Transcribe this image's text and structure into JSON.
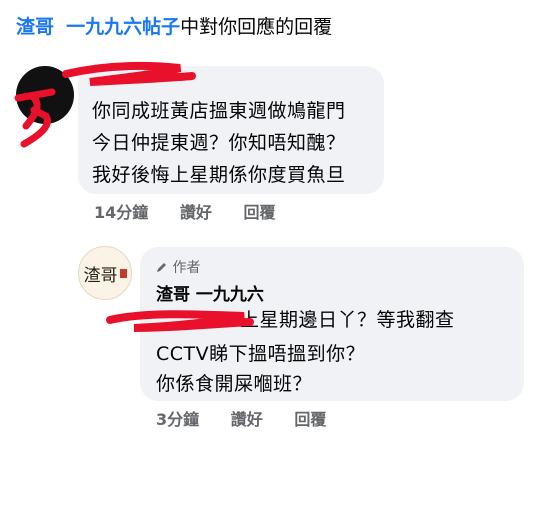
{
  "header": {
    "user": "渣哥",
    "post": "一九九六帖子",
    "suffix": "中對你回應的回覆"
  },
  "comment": {
    "lines": [
      "你同成班黃店搵東週做鳩龍門",
      "今日仲提東週？你知唔知醜？",
      "我好後悔上星期係你度買魚旦"
    ],
    "time": "14分鐘",
    "like": "讚好",
    "reply": "回覆"
  },
  "reply": {
    "badge": "作者",
    "author": "渣哥 一九九六",
    "lines": [
      "上星期邊日丫？等我翻查",
      "CCTV睇下搵唔搵到你？",
      "你係食開屎嗰班？"
    ],
    "time": "3分鐘",
    "like": "讚好",
    "reply": "回覆",
    "avatar_text": "渣哥"
  }
}
